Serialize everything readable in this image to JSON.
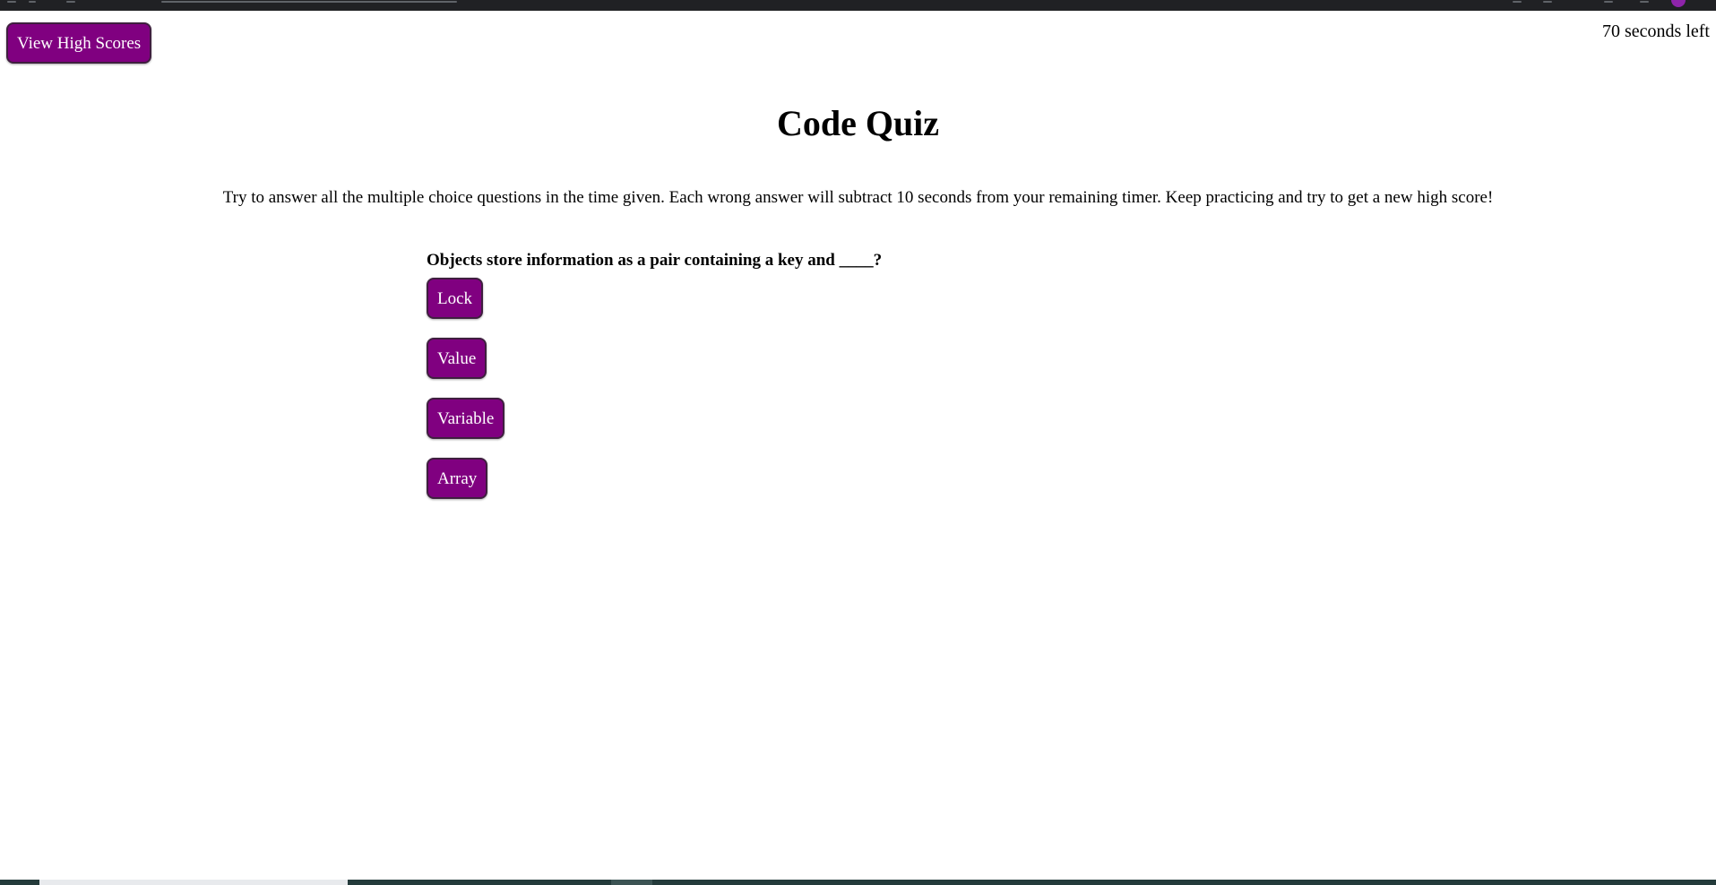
{
  "header": {
    "high_scores_label": "View High Scores",
    "timer_text": "70 seconds left"
  },
  "main": {
    "title": "Code Quiz",
    "instructions": "Try to answer all the multiple choice questions in the time given. Each wrong answer will subtract 10 seconds from your remaining timer. Keep practicing and try to get a new high score!"
  },
  "quiz": {
    "question": "Objects store information as a pair containing a key and ____?",
    "choices": [
      "Lock",
      "Value",
      "Variable",
      "Array"
    ]
  },
  "colors": {
    "button_background": "#800080",
    "button_text": "#ffffff",
    "page_background": "#ffffff"
  }
}
